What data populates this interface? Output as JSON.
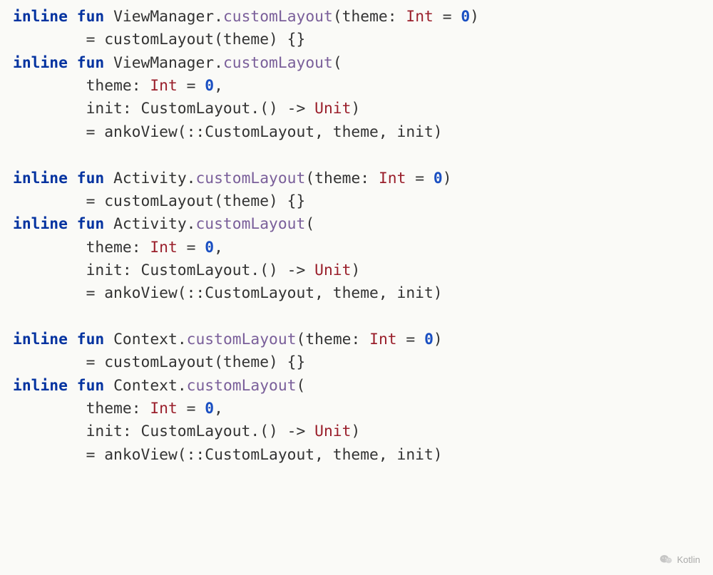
{
  "tokens": {
    "kw_inline": "inline",
    "kw_fun": "fun",
    "recv_viewmanager": "ViewManager",
    "recv_activity": "Activity",
    "recv_context": "Context",
    "fn_customLayout": "customLayout",
    "param_theme": "theme",
    "type_int": "Int",
    "lit_zero": "0",
    "body_call_theme": "customLayout(theme) {}",
    "param_init_prefix": "init: CustomLayout.() ",
    "arrow": "->",
    "type_unit": "Unit",
    "body_ankoview": "ankoView(::CustomLayout, theme, init)"
  },
  "watermark_label": "Kotlin"
}
